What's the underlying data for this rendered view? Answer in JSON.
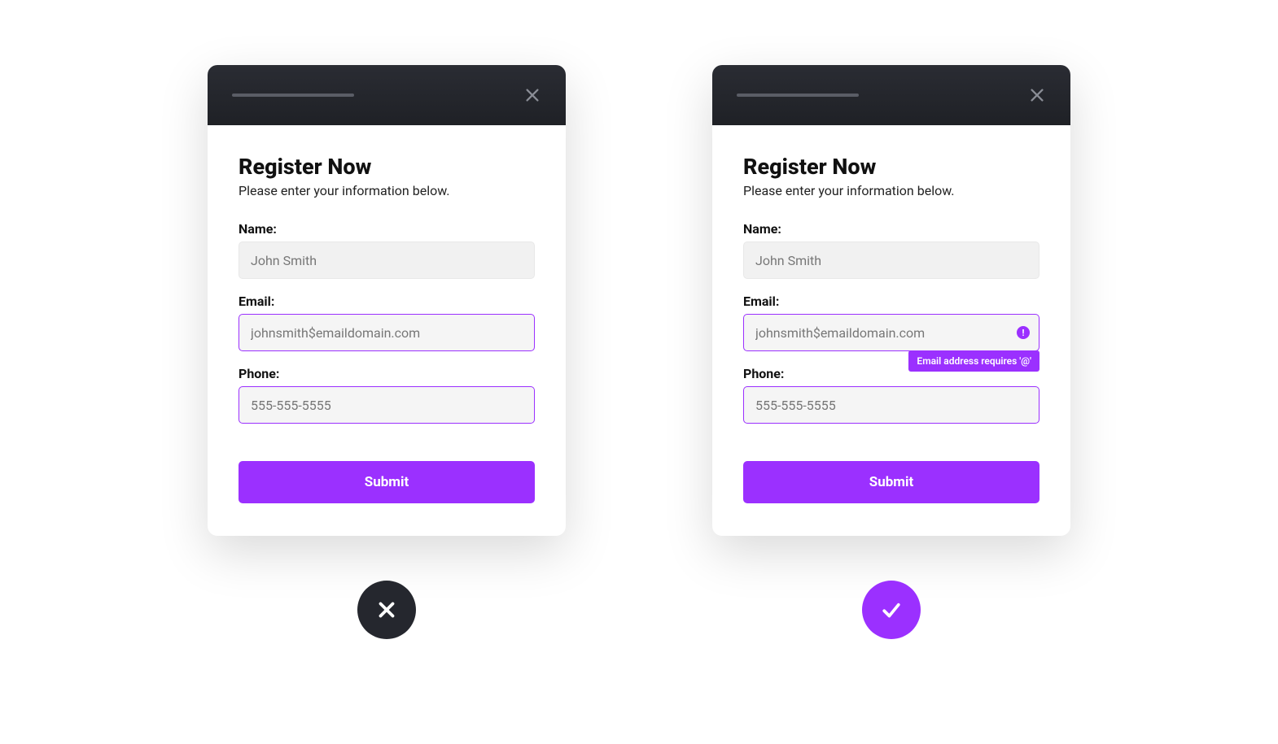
{
  "form": {
    "title": "Register Now",
    "subtitle": "Please enter your information below.",
    "fields": {
      "name": {
        "label": "Name:",
        "value": "John Smith"
      },
      "email": {
        "label": "Email:",
        "value": "johnsmith$emaildomain.com",
        "error_message": "Email address requires '@'"
      },
      "phone": {
        "label": "Phone:",
        "value": "555-555-5555"
      }
    },
    "submit_label": "Submit"
  },
  "colors": {
    "accent": "#9B30FF",
    "header_dark": "#25272e"
  }
}
